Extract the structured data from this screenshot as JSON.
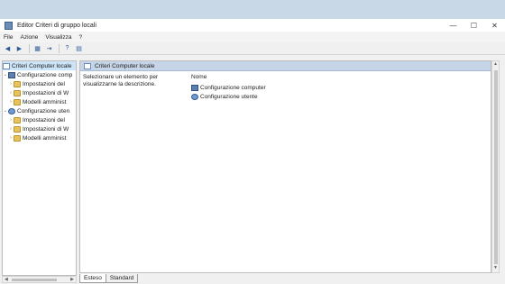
{
  "window": {
    "title": "Editor Criteri di gruppo locali",
    "controls": {
      "minimize": "—",
      "maximize": "☐",
      "close": "✕"
    }
  },
  "menu": [
    "File",
    "Azione",
    "Visualizza",
    "?"
  ],
  "toolbar": {
    "icons": [
      "back-icon",
      "forward-icon",
      "show-hide-tree-icon",
      "export-list-icon",
      "help-icon",
      "properties-icon"
    ],
    "glyphs": {
      "back": "◀",
      "forward": "▶",
      "tree": "▦",
      "export": "⇥",
      "help": "?",
      "props": "▤"
    }
  },
  "tree": {
    "root": "Criteri Computer locale",
    "computer_config": "Configurazione comp",
    "computer_children": [
      "Impostazioni del",
      "Impostazioni di W",
      "Modelli amminist"
    ],
    "user_config": "Configurazione uten",
    "user_children": [
      "Impostazioni del",
      "Impostazioni di W",
      "Modelli amminist"
    ]
  },
  "main": {
    "header": "Criteri Computer locale",
    "description": "Selezionare un elemento per visualizzarne la descrizione.",
    "list_header": "Nome",
    "items": [
      "Configurazione computer",
      "Configurazione utente"
    ]
  },
  "tabs": [
    "Esteso",
    "Standard"
  ],
  "active_tab": "Esteso",
  "colors": {
    "header_band": "#c5d4e6",
    "selection": "#cce4f7",
    "folder": "#e7c35a"
  }
}
